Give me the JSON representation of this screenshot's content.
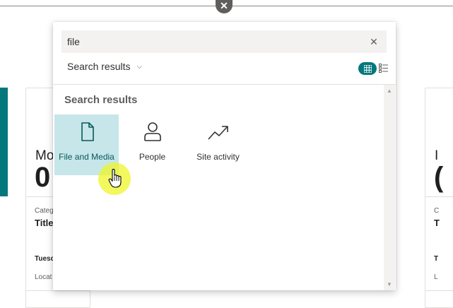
{
  "close": {
    "icon": "close-icon",
    "glyph": "✕"
  },
  "background": {
    "card_left": {
      "big_label": "Mo",
      "big_number": "0",
      "category": "Categ",
      "title": "Title",
      "day": "Tuesd",
      "location": "Locat"
    },
    "card_right": {
      "big_label": "I",
      "big_number": "(",
      "category": "C",
      "title": "T",
      "day": "T",
      "location": "L"
    }
  },
  "search": {
    "value": "file",
    "placeholder": "",
    "clear_icon": "close-icon",
    "clear_glyph": "✕"
  },
  "scope": {
    "label": "Search results",
    "chevron": "chevron-down-icon",
    "glyph": "⌵"
  },
  "view_toggle": {
    "grid_icon": "grid-icon",
    "list_icon": "list-icon",
    "selected": "grid"
  },
  "results": {
    "title": "Search results",
    "items": [
      {
        "label": "File and Media",
        "icon": "document-icon",
        "selected": true
      },
      {
        "label": "People",
        "icon": "person-icon",
        "selected": false
      },
      {
        "label": "Site activity",
        "icon": "trending-up-icon",
        "selected": false
      }
    ]
  },
  "scrollbar": {
    "up": "▲",
    "down": "▼"
  },
  "colors": {
    "accent": "#03787c",
    "selected_tile": "#c7e6e9",
    "cursor_highlight": "#eef528"
  }
}
